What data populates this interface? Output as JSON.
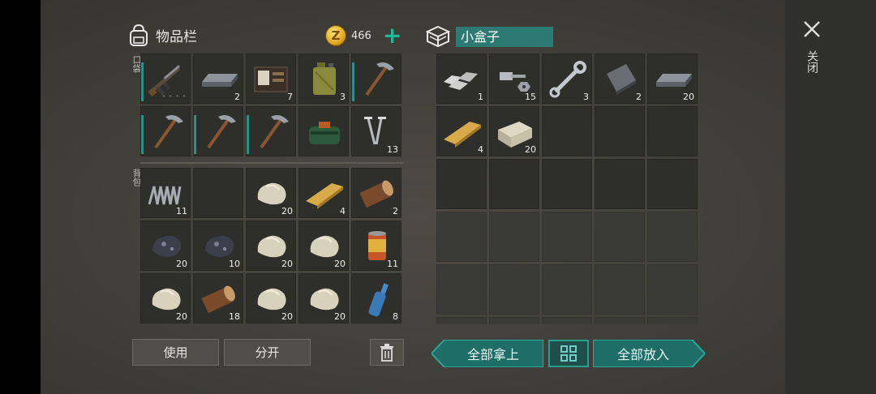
{
  "inventory": {
    "title": "物品栏",
    "coins": "466",
    "pocket_label": "口袋",
    "backpack_label": "背包",
    "pocket": [
      {
        "icon": "rifle-icon",
        "qty": "",
        "durability": true,
        "dots": "• • • •"
      },
      {
        "icon": "iron-bar-icon",
        "qty": "2"
      },
      {
        "icon": "wallet-icon",
        "qty": "7"
      },
      {
        "icon": "jerrycan-icon",
        "qty": "3"
      },
      {
        "icon": "pickaxe-icon",
        "qty": "",
        "durability": true
      },
      {
        "icon": "pickaxe-icon",
        "qty": "",
        "durability": true
      },
      {
        "icon": "pickaxe-icon",
        "qty": "",
        "durability": true
      },
      {
        "icon": "pickaxe-icon",
        "qty": "",
        "durability": true
      },
      {
        "icon": "bag-icon",
        "qty": ""
      },
      {
        "icon": "nails-icon",
        "qty": "13"
      }
    ],
    "backpack": [
      {
        "icon": "spring-icon",
        "qty": "11"
      },
      {
        "icon": "",
        "qty": ""
      },
      {
        "icon": "stone-icon",
        "qty": "20"
      },
      {
        "icon": "plank-icon",
        "qty": "4"
      },
      {
        "icon": "log-icon",
        "qty": "2"
      },
      {
        "icon": "ore-icon",
        "qty": "20"
      },
      {
        "icon": "ore-icon",
        "qty": "10"
      },
      {
        "icon": "stone-icon",
        "qty": "20"
      },
      {
        "icon": "stone-icon",
        "qty": "20"
      },
      {
        "icon": "can-icon",
        "qty": "11"
      },
      {
        "icon": "stone-icon",
        "qty": "20"
      },
      {
        "icon": "log-icon",
        "qty": "18"
      },
      {
        "icon": "stone-icon",
        "qty": "20"
      },
      {
        "icon": "stone-icon",
        "qty": "20"
      },
      {
        "icon": "bottle-icon",
        "qty": "8"
      }
    ],
    "use_label": "使用",
    "split_label": "分开"
  },
  "container": {
    "name": "小盒子",
    "items": [
      {
        "icon": "scrap-metal-icon",
        "qty": "1"
      },
      {
        "icon": "bolt-nut-icon",
        "qty": "15"
      },
      {
        "icon": "wrench-icon",
        "qty": "3"
      },
      {
        "icon": "metal-plate-icon",
        "qty": "2"
      },
      {
        "icon": "iron-bar-icon",
        "qty": "20"
      },
      {
        "icon": "plank-icon",
        "qty": "4"
      },
      {
        "icon": "stone-block-icon",
        "qty": "20"
      }
    ],
    "take_all_label": "全部拿上",
    "put_all_label": "全部放入"
  },
  "close_label": "关闭",
  "colors": {
    "accent": "#1fb89a",
    "teal_button": "#1e6e67",
    "box_name_bg": "#2c7a72"
  }
}
